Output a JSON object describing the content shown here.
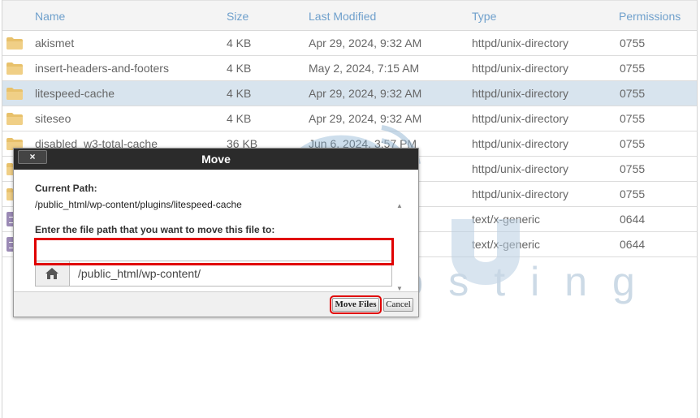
{
  "table": {
    "headers": {
      "name": "Name",
      "size": "Size",
      "modified": "Last Modified",
      "type": "Type",
      "perms": "Permissions"
    },
    "rows": [
      {
        "icon": "folder-icon",
        "name": "akismet",
        "size": "4 KB",
        "modified": "Apr 29, 2024, 9:32 AM",
        "type": "httpd/unix-directory",
        "perms": "0755"
      },
      {
        "icon": "folder-icon",
        "name": "insert-headers-and-footers",
        "size": "4 KB",
        "modified": "May 2, 2024, 7:15 AM",
        "type": "httpd/unix-directory",
        "perms": "0755"
      },
      {
        "icon": "folder-icon",
        "name": "litespeed-cache",
        "size": "4 KB",
        "modified": "Apr 29, 2024, 9:32 AM",
        "type": "httpd/unix-directory",
        "perms": "0755",
        "selected": true
      },
      {
        "icon": "folder-icon",
        "name": "siteseo",
        "size": "4 KB",
        "modified": "Apr 29, 2024, 9:32 AM",
        "type": "httpd/unix-directory",
        "perms": "0755"
      },
      {
        "icon": "folder-icon",
        "name": "disabled_w3-total-cache",
        "size": "36 KB",
        "modified": "Jun 6, 2024, 3:57 PM",
        "type": "httpd/unix-directory",
        "perms": "0755"
      },
      {
        "icon": "folder-icon",
        "name": "",
        "size": "",
        "modified": "M",
        "type": "httpd/unix-directory",
        "perms": "0755"
      },
      {
        "icon": "folder-icon",
        "name": "",
        "size": "",
        "modified": "",
        "type": "httpd/unix-directory",
        "perms": "0755"
      },
      {
        "icon": "file-icon",
        "name": "",
        "size": "",
        "modified": "AM",
        "type": "text/x-generic",
        "perms": "0644"
      },
      {
        "icon": "file-icon",
        "name": "",
        "size": "",
        "modified": "",
        "type": "text/x-generic",
        "perms": "0644"
      }
    ]
  },
  "dialog": {
    "title": "Move",
    "close_label": "×",
    "current_path_label": "Current Path:",
    "current_path": "/public_html/wp-content/plugins/litespeed-cache",
    "target_label": "Enter the file path that you want to move this file to:",
    "target_value": "/public_html/wp-content/",
    "move_button": "Move Files",
    "cancel_button": "Cancel"
  },
  "watermark": {
    "text": "web hosting"
  },
  "colors": {
    "header_text": "#6fa0cc",
    "selected_row": "#d8e4ee",
    "highlight": "#e00000",
    "dialog_title_bg": "#2b2b2b",
    "folder": "#e8c16b"
  }
}
